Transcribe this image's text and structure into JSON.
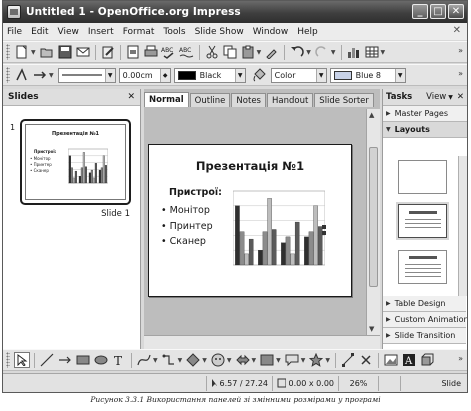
{
  "window": {
    "title": "Untitled 1 - OpenOffice.org Impress",
    "minimize_glyph": "_",
    "maximize_glyph": "□",
    "close_glyph": "✕"
  },
  "menu": {
    "items": [
      "File",
      "Edit",
      "View",
      "Insert",
      "Format",
      "Tools",
      "Slide Show",
      "Window",
      "Help"
    ],
    "close_glyph": "✕"
  },
  "line_toolbar": {
    "line_width": "0.00cm",
    "line_color": "Black",
    "line_color_hex": "#000000",
    "area_style": "Color",
    "area_color": "Blue 8",
    "area_color_hex": "#c8d2e8"
  },
  "slides_pane": {
    "title": "Slides",
    "close_glyph": "✕",
    "slide_number": "1",
    "slide_caption": "Slide 1"
  },
  "editor": {
    "tabs": [
      "Normal",
      "Outline",
      "Notes",
      "Handout",
      "Slide Sorter"
    ],
    "active_tab": "Normal"
  },
  "slide": {
    "title": "Презентація №1",
    "body_heading": "Пристрої:",
    "bullets": [
      "Монітор",
      "Принтер",
      "Сканер"
    ],
    "chart_data": {
      "type": "bar",
      "categories": [
        "1",
        "2",
        "3",
        "4"
      ],
      "series": [
        {
          "values": [
            8.0,
            2.0,
            3.0,
            3.8
          ],
          "color": "#2f2f2f"
        },
        {
          "values": [
            4.5,
            4.5,
            3.8,
            4.5
          ],
          "color": "#8c8c8c"
        },
        {
          "values": [
            1.5,
            9.0,
            1.5,
            8.0
          ],
          "color": "#bdbdbd"
        },
        {
          "values": [
            3.5,
            4.8,
            5.8,
            5.2
          ],
          "color": "#5a5a5a"
        }
      ],
      "ylim": [
        0,
        10
      ],
      "grid": true
    }
  },
  "tasks_pane": {
    "title": "Tasks",
    "view_label": "View",
    "close_glyph": "✕",
    "master_pages": "Master Pages",
    "layouts": "Layouts",
    "bottom_sections": [
      "Table Design",
      "Custom Animation",
      "Slide Transition"
    ]
  },
  "status": {
    "position": "6.57 / 27.24",
    "size": "0.00 x 0.00",
    "zoom": "26%",
    "slide_label": "Slide"
  },
  "caption": "Рисунок 3.3.1 Використання панелей зі змінними розмірами у програмі"
}
